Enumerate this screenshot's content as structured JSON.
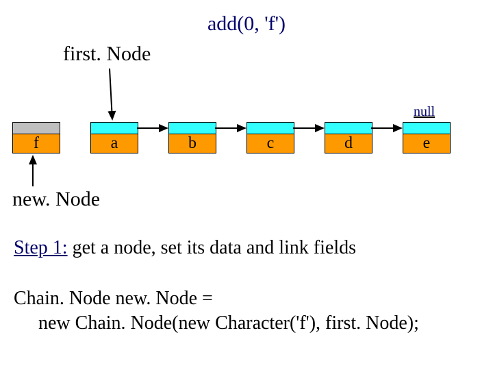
{
  "title": "add(0, 'f')",
  "labels": {
    "firstNode": "first. Node",
    "newNode": "new. Node",
    "null": "null"
  },
  "nodes": {
    "f": "f",
    "a": "a",
    "b": "b",
    "c": "c",
    "d": "d",
    "e": "e"
  },
  "step": {
    "prefix": "Step 1:",
    "rest": " get a node, set its data and link fields"
  },
  "code": {
    "line1": "Chain. Node new. Node =",
    "line2": "new Chain. Node(new Character('f'), first. Node);"
  },
  "colors": {
    "cyan": "#33ffff",
    "orange": "#ff9900",
    "gray": "#bfbfbf",
    "titleBlue": "#00006a"
  }
}
